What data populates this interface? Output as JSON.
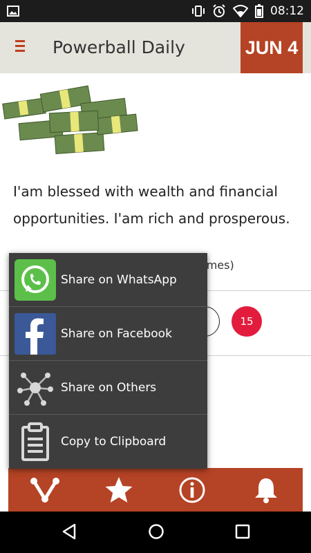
{
  "status_bar": {
    "time": "08:12"
  },
  "header": {
    "title": "Powerball Daily",
    "date_badge": "JUN 4"
  },
  "content": {
    "affirmation": "I'am blessed with wealth and financial opportunities. I'am rich and prosperous.",
    "times_suffix": "times)",
    "count_badge": "15"
  },
  "share_popup": {
    "items": [
      {
        "label": "Share on WhatsApp",
        "icon": "whatsapp-icon"
      },
      {
        "label": "Share on Facebook",
        "icon": "facebook-icon"
      },
      {
        "label": "Share on Others",
        "icon": "share-network-icon"
      },
      {
        "label": "Copy to Clipboard",
        "icon": "clipboard-icon"
      }
    ]
  },
  "bottom_bar": {
    "icons": [
      "share-icon",
      "star-icon",
      "info-icon",
      "bell-icon"
    ]
  },
  "colors": {
    "accent": "#b54325",
    "badge_red": "#e31c3d",
    "header_bg": "#e4e4dc",
    "popup_bg": "#3d3d3d"
  }
}
